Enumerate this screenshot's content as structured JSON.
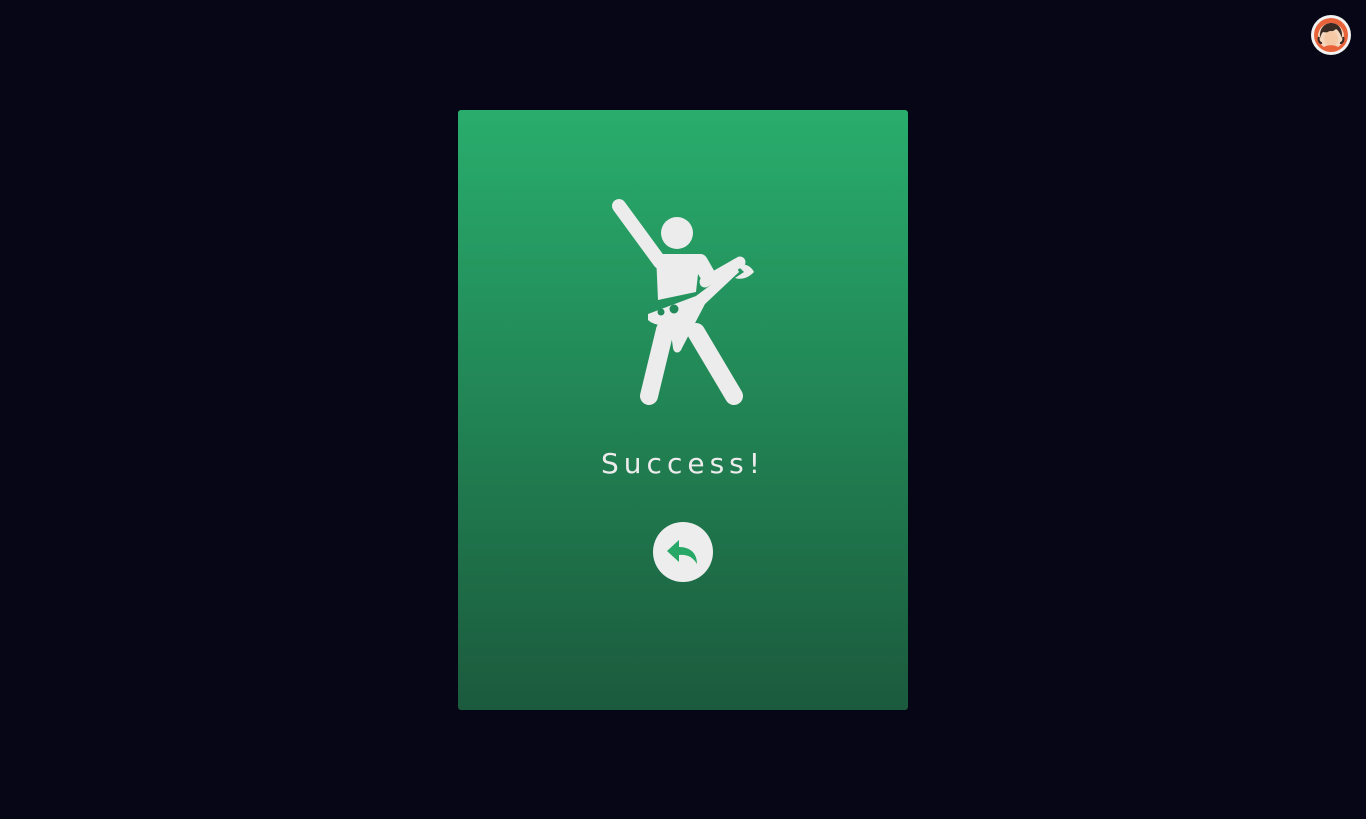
{
  "app": {
    "background_color": "#060616"
  },
  "header": {
    "avatar": {
      "icon": "user-avatar-icon",
      "colors": {
        "ring": "#e8623a",
        "face": "#f6c9a6",
        "hair": "#3a2a24",
        "background": "#f2f2f2"
      }
    }
  },
  "result_card": {
    "illustration_icon": "rock-guitarist-icon",
    "message": "Success!",
    "back_button": {
      "icon": "reply-arrow-icon"
    },
    "colors": {
      "gradient_top": "#29ad6d",
      "gradient_bottom": "#1b5a3d",
      "foreground": "#ececec",
      "accent": "#27a866"
    }
  }
}
